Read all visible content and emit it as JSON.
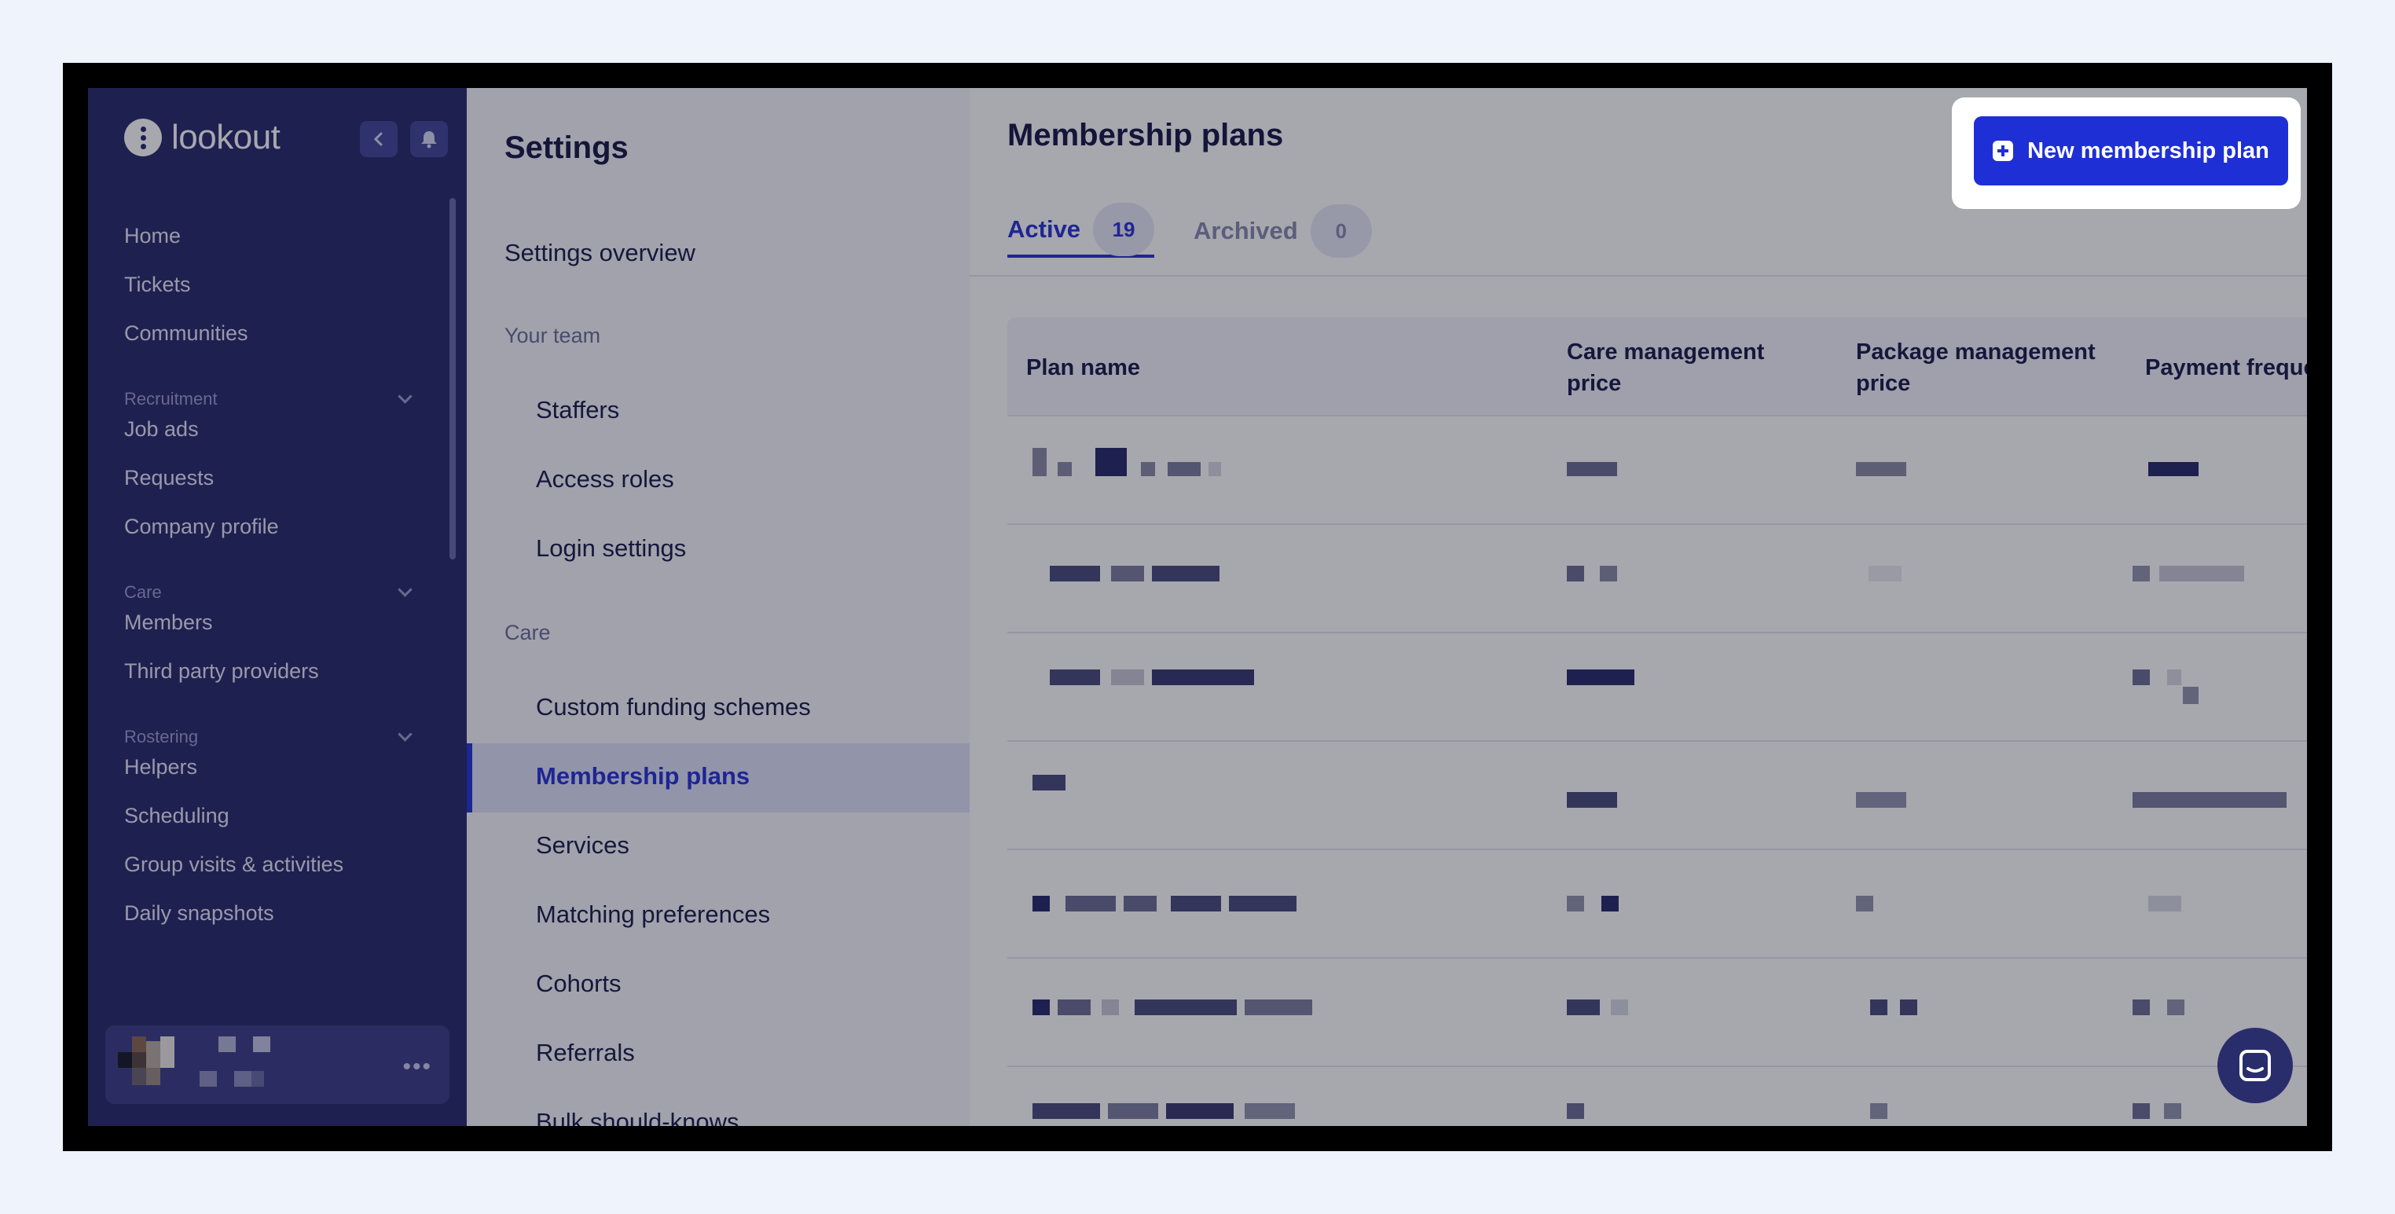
{
  "brand": {
    "name": "lookout"
  },
  "nav": {
    "items_top": [
      "Home",
      "Tickets",
      "Communities"
    ],
    "groups": [
      {
        "label": "Recruitment",
        "items": [
          "Job ads",
          "Requests",
          "Company profile"
        ]
      },
      {
        "label": "Care",
        "items": [
          "Members",
          "Third party providers"
        ]
      },
      {
        "label": "Rostering",
        "items": [
          "Helpers",
          "Scheduling",
          "Group visits & activities",
          "Daily snapshots"
        ]
      }
    ],
    "more_label": "•••"
  },
  "settings": {
    "title": "Settings",
    "overview": "Settings overview",
    "team_heading": "Your team",
    "team_items": [
      "Staffers",
      "Access roles",
      "Login settings"
    ],
    "care_heading": "Care",
    "care_items": [
      "Custom funding schemes",
      "Membership plans",
      "Services",
      "Matching preferences",
      "Cohorts",
      "Referrals",
      "Bulk should-knows"
    ],
    "active_item": "Membership plans"
  },
  "main": {
    "title": "Membership plans",
    "new_button": "New membership plan",
    "tabs": [
      {
        "label": "Active",
        "count": "19"
      },
      {
        "label": "Archived",
        "count": "0"
      }
    ],
    "columns": [
      "Plan name",
      "Care management price",
      "Package management price",
      "Payment freque"
    ]
  },
  "colors": {
    "accent": "#1f2fd6",
    "nav_bg": "#2a2d6c",
    "overlay": "rgba(10,12,30,0.36)"
  },
  "icons": [
    "back-chevron-icon",
    "bell-icon",
    "chevron-down-icon",
    "plus-square-icon",
    "chat-icon"
  ]
}
